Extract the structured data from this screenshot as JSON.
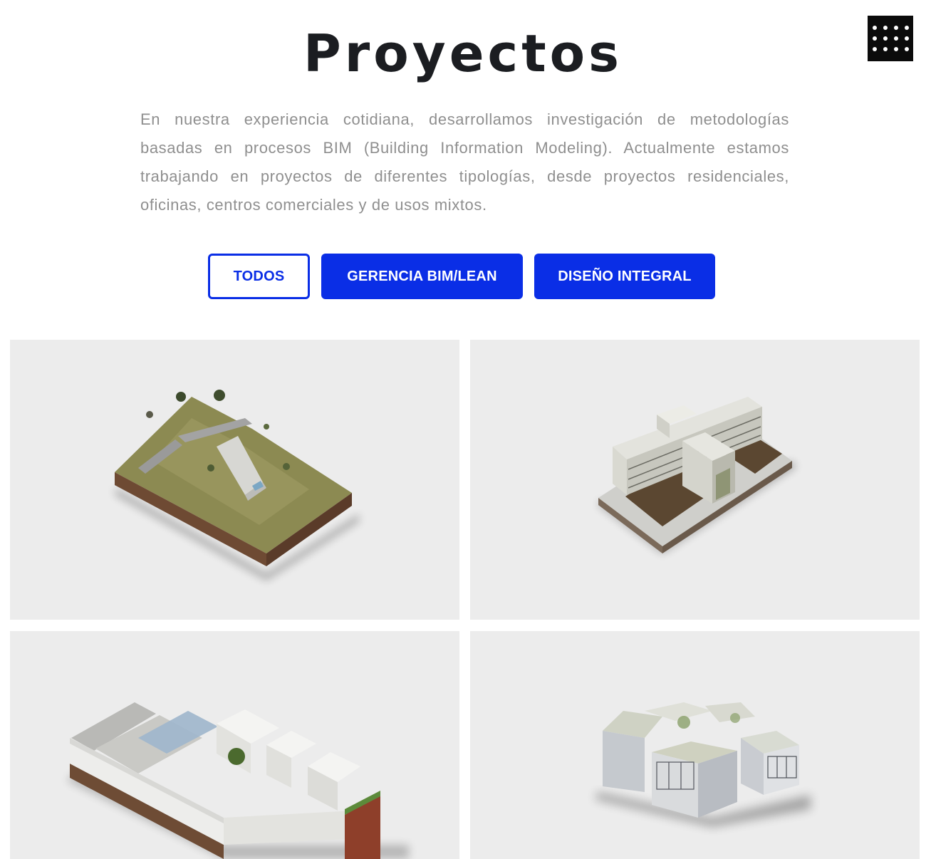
{
  "header": {
    "title": "Proyectos",
    "menu_icon": "grid-dots-icon"
  },
  "intro": {
    "text": "En nuestra experiencia cotidiana, desarrollamos investigación de metodologías basadas en procesos BIM (Building Information Modeling). Actualmente estamos trabajando en proyectos de diferentes tipologías, desde proyectos residenciales, oficinas, centros comerciales y de usos mixtos."
  },
  "filters": {
    "all": "TODOS",
    "bim_lean": "GERENCIA BIM/LEAN",
    "integral_design": "DISEÑO INTEGRAL",
    "active": "TODOS"
  },
  "projects": [
    {
      "thumbnail": "hillside-terrain-house-model"
    },
    {
      "thumbnail": "courtyard-apartment-block-model"
    },
    {
      "thumbnail": "l-shaped-white-building-model"
    },
    {
      "thumbnail": "clustered-glass-volumes-model"
    }
  ],
  "colors": {
    "accent": "#0a2ee6",
    "title": "#1b1d21",
    "body_text": "#8f8f8f",
    "card_bg": "#ececec",
    "menu_bg": "#0b0b0b"
  }
}
